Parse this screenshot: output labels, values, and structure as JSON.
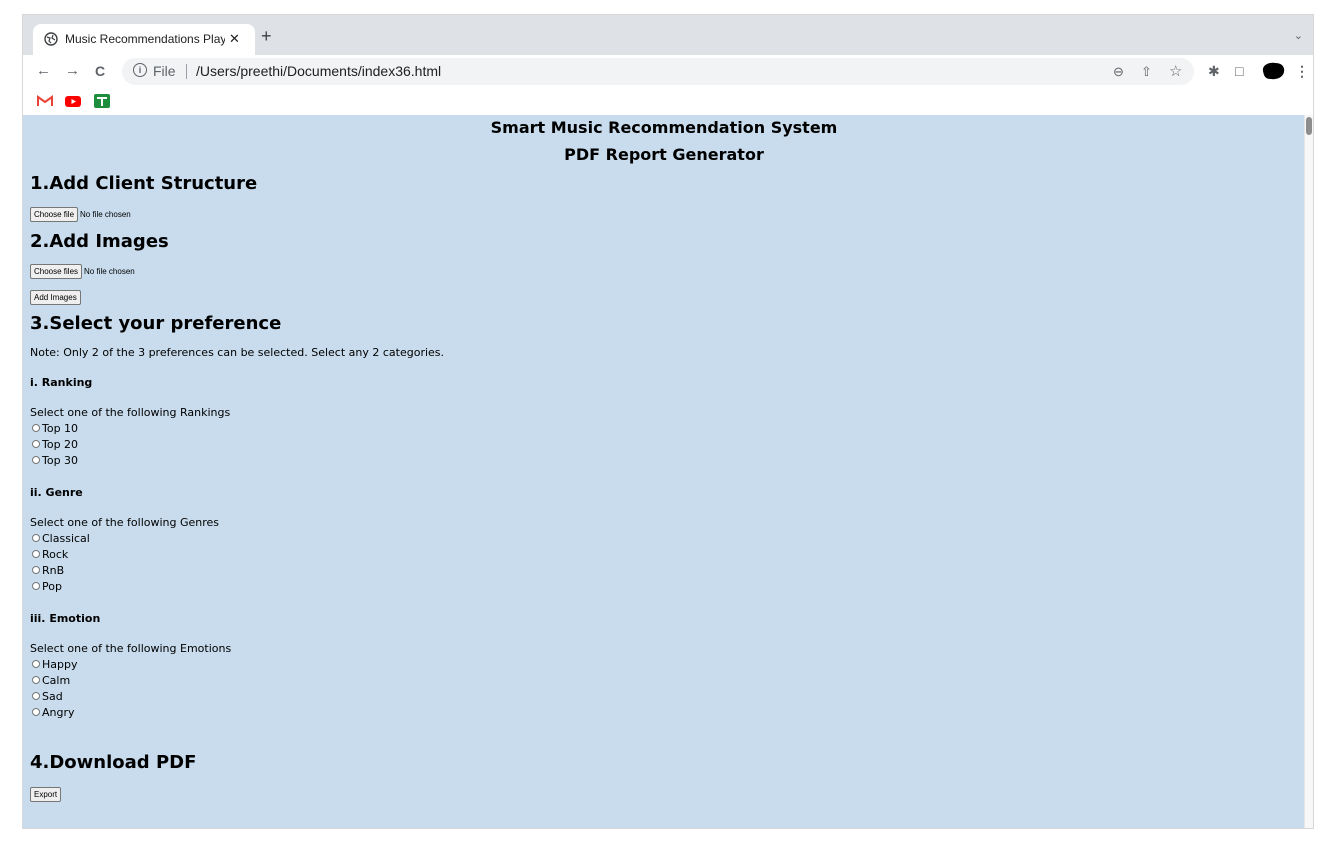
{
  "browser": {
    "tab_title": "Music Recommendations PlayC",
    "tab_close": "✕",
    "new_tab": "+",
    "tab_dropdown": "⌄",
    "back": "←",
    "forward": "→",
    "reload": "C",
    "info": "i",
    "scheme": "File",
    "url": "/Users/preethi/Documents/index36.html",
    "zoom_icon": "⊖",
    "share_icon": "⇧",
    "star_icon": "☆",
    "extensions_icon": "✱",
    "sidepanel_icon": "□",
    "menu_icon": "⋮",
    "bookmarks": [
      "gmail-icon",
      "youtube-icon",
      "sheets-icon"
    ]
  },
  "page": {
    "title": "Smart Music Recommendation System",
    "subtitle": "PDF Report Generator",
    "section1": {
      "heading": "1.Add Client Structure",
      "button": "Choose file",
      "status": "No file chosen"
    },
    "section2": {
      "heading": "2.Add Images",
      "button": "Choose files",
      "status": "No file chosen",
      "add_button": "Add Images"
    },
    "section3": {
      "heading": "3.Select your preference",
      "note": "Note: Only 2 of the 3 preferences can be selected. Select any 2 categories.",
      "ranking": {
        "heading": "i. Ranking",
        "prompt": "Select one of the following Rankings",
        "options": [
          "Top 10",
          "Top 20",
          "Top 30"
        ]
      },
      "genre": {
        "heading": "ii. Genre",
        "prompt": "Select one of the following Genres",
        "options": [
          "Classical",
          "Rock",
          "RnB",
          "Pop"
        ]
      },
      "emotion": {
        "heading": "iii. Emotion",
        "prompt": "Select one of the following Emotions",
        "options": [
          "Happy",
          "Calm",
          "Sad",
          "Angry"
        ]
      }
    },
    "section4": {
      "heading": "4.Download PDF",
      "button": "Export"
    }
  },
  "colors": {
    "page_background": "#c8dced",
    "tabbar": "#dee1e6"
  }
}
